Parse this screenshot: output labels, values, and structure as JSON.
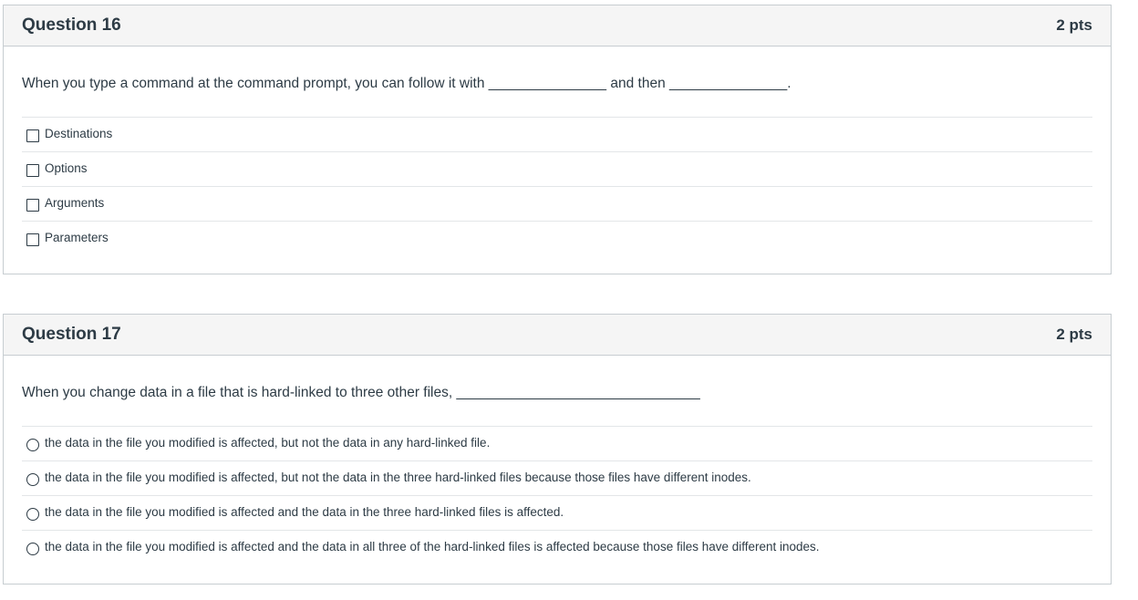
{
  "questions": [
    {
      "title": "Question 16",
      "points": "2 pts",
      "prompt": "When you type a command at the command prompt, you can follow it with _______________ and then _______________.",
      "input_type": "checkbox",
      "answers": [
        "Destinations",
        "Options",
        "Arguments",
        "Parameters"
      ]
    },
    {
      "title": "Question 17",
      "points": "2 pts",
      "prompt": "When you change data in a file that is hard-linked to three other files, _______________________________",
      "input_type": "radio",
      "answers": [
        "the data in the file you modified is affected, but not the data in any hard-linked file.",
        "the data in the file you modified is affected, but not the data in the three hard-linked files because those files have different inodes.",
        "the data in the file you modified is affected and the data in the three hard-linked files is affected.",
        "the data in the file you modified is affected and the data in all three of the hard-linked files is affected because those files have different inodes."
      ]
    }
  ]
}
